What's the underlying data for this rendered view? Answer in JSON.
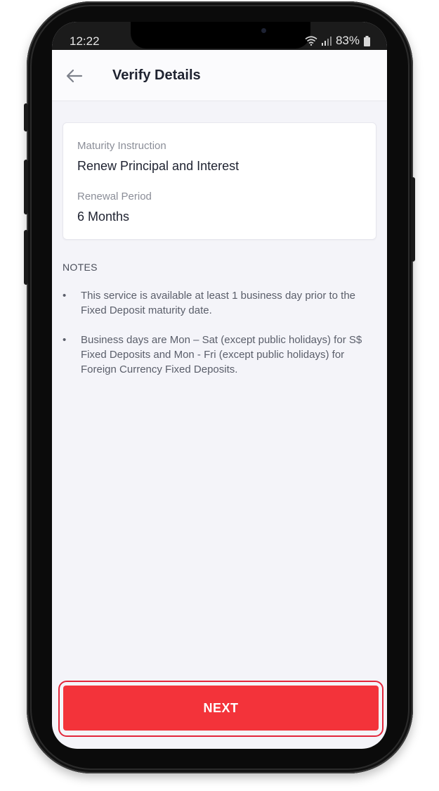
{
  "status_bar": {
    "time": "12:22",
    "battery": "83%"
  },
  "header": {
    "title": "Verify Details"
  },
  "details": {
    "maturity_instruction_label": "Maturity Instruction",
    "maturity_instruction_value": "Renew Principal and Interest",
    "renewal_period_label": "Renewal Period",
    "renewal_period_value": "6 Months"
  },
  "notes": {
    "title": "NOTES",
    "bullet": "•",
    "items": [
      "This service is available at least 1 business day prior to the Fixed Deposit maturity date.",
      "Business days are Mon – Sat (except public holidays) for S$ Fixed Deposits and Mon - Fri (except public holidays) for Foreign Currency Fixed Deposits."
    ]
  },
  "footer": {
    "next_label": "NEXT"
  },
  "colors": {
    "accent": "#f3333a",
    "highlight_border": "#e2263a"
  },
  "icons": {
    "back": "back-arrow-icon",
    "wifi": "wifi-icon",
    "signal": "signal-icon",
    "battery": "battery-icon"
  }
}
